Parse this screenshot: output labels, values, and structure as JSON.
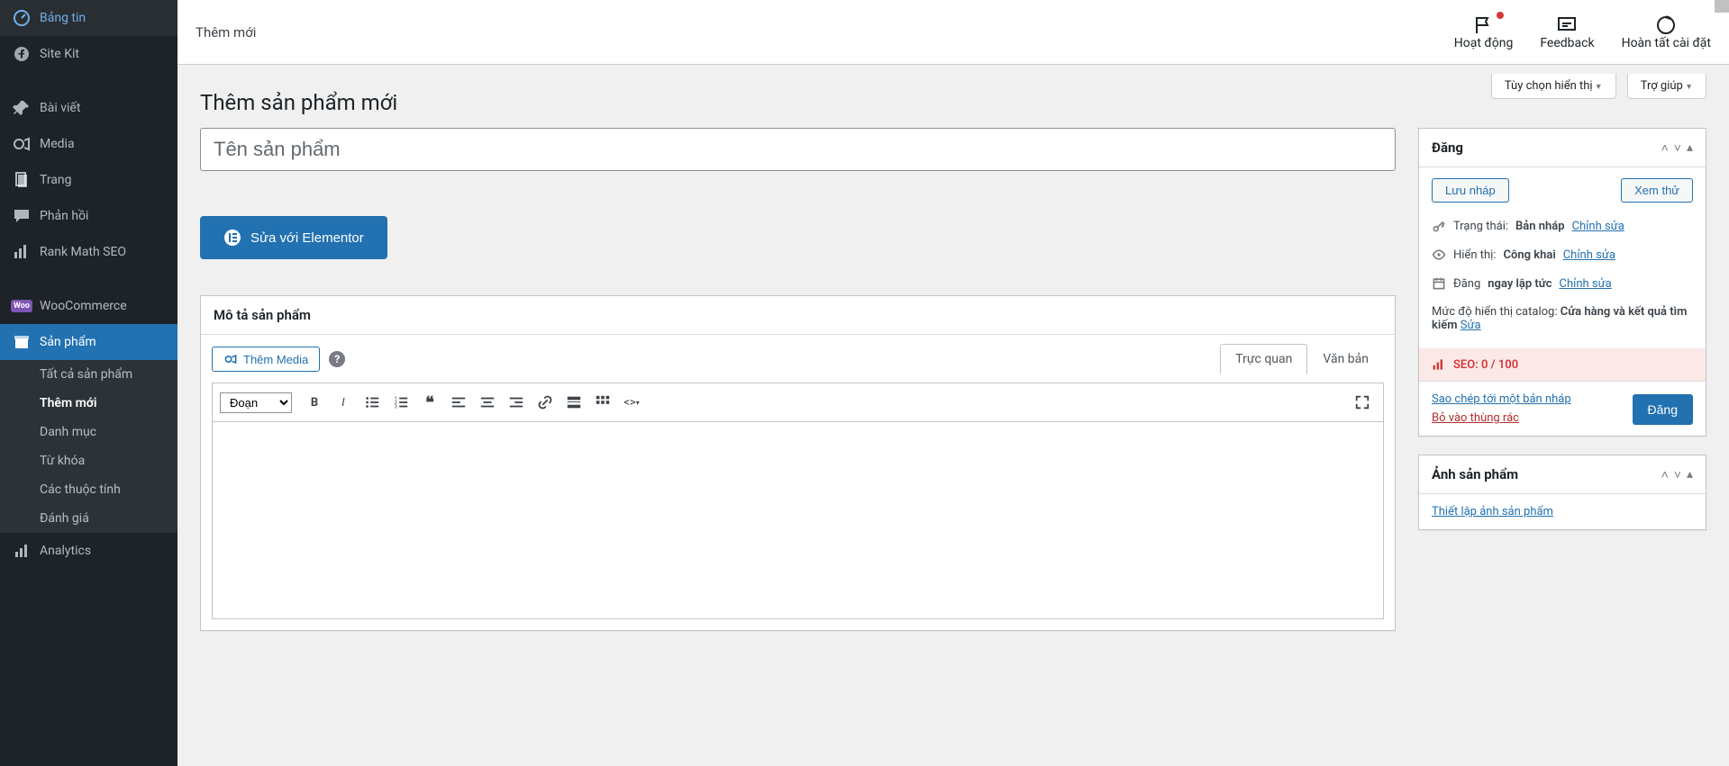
{
  "sidebar": {
    "items": [
      {
        "label": "Bảng tin",
        "icon": "dashboard"
      },
      {
        "label": "Site Kit",
        "icon": "sitekit"
      },
      {
        "label": "Bài viết",
        "icon": "pin"
      },
      {
        "label": "Media",
        "icon": "media"
      },
      {
        "label": "Trang",
        "icon": "page"
      },
      {
        "label": "Phản hồi",
        "icon": "comment"
      },
      {
        "label": "Rank Math SEO",
        "icon": "seo"
      },
      {
        "label": "WooCommerce",
        "icon": "woo"
      },
      {
        "label": "Sản phẩm",
        "icon": "product"
      },
      {
        "label": "Analytics",
        "icon": "analytics"
      }
    ],
    "submenu": [
      "Tất cả sản phẩm",
      "Thêm mới",
      "Danh mục",
      "Từ khóa",
      "Các thuộc tính",
      "Đánh giá"
    ],
    "submenu_current": "Thêm mới"
  },
  "topbar": {
    "breadcrumb": "Thêm mới",
    "right": [
      {
        "label": "Hoạt động",
        "icon": "flag"
      },
      {
        "label": "Feedback",
        "icon": "chat"
      },
      {
        "label": "Hoàn tất cài đặt",
        "icon": "progress"
      }
    ]
  },
  "screen_meta": {
    "options": "Tùy chọn hiển thị",
    "help": "Trợ giúp"
  },
  "page": {
    "title": "Thêm sản phẩm mới",
    "product_name_placeholder": "Tên sản phẩm",
    "elementor_button": "Sửa với Elementor",
    "description_heading": "Mô tả sản phẩm",
    "add_media": "Thêm Media",
    "visual_tab": "Trực quan",
    "text_tab": "Văn bản",
    "format_select": "Đoạn"
  },
  "publish_box": {
    "title": "Đăng",
    "save_draft": "Lưu nháp",
    "preview": "Xem thử",
    "status_label": "Trạng thái:",
    "status_value": "Bản nháp",
    "edit": "Chỉnh sửa",
    "visibility_label": "Hiển thị:",
    "visibility_value": "Công khai",
    "publish_label": "Đăng",
    "publish_value": "ngay lập tức",
    "catalog_label": "Mức độ hiển thị catalog:",
    "catalog_value": "Cửa hàng và kết quả tìm kiếm",
    "catalog_edit": "Sửa",
    "seo_label": "SEO: 0 / 100",
    "copy_link": "Sao chép tới một bản nháp",
    "trash": "Bỏ vào thùng rác",
    "publish_btn": "Đăng"
  },
  "image_box": {
    "title": "Ảnh sản phẩm",
    "set_link": "Thiết lập ảnh sản phẩm"
  }
}
